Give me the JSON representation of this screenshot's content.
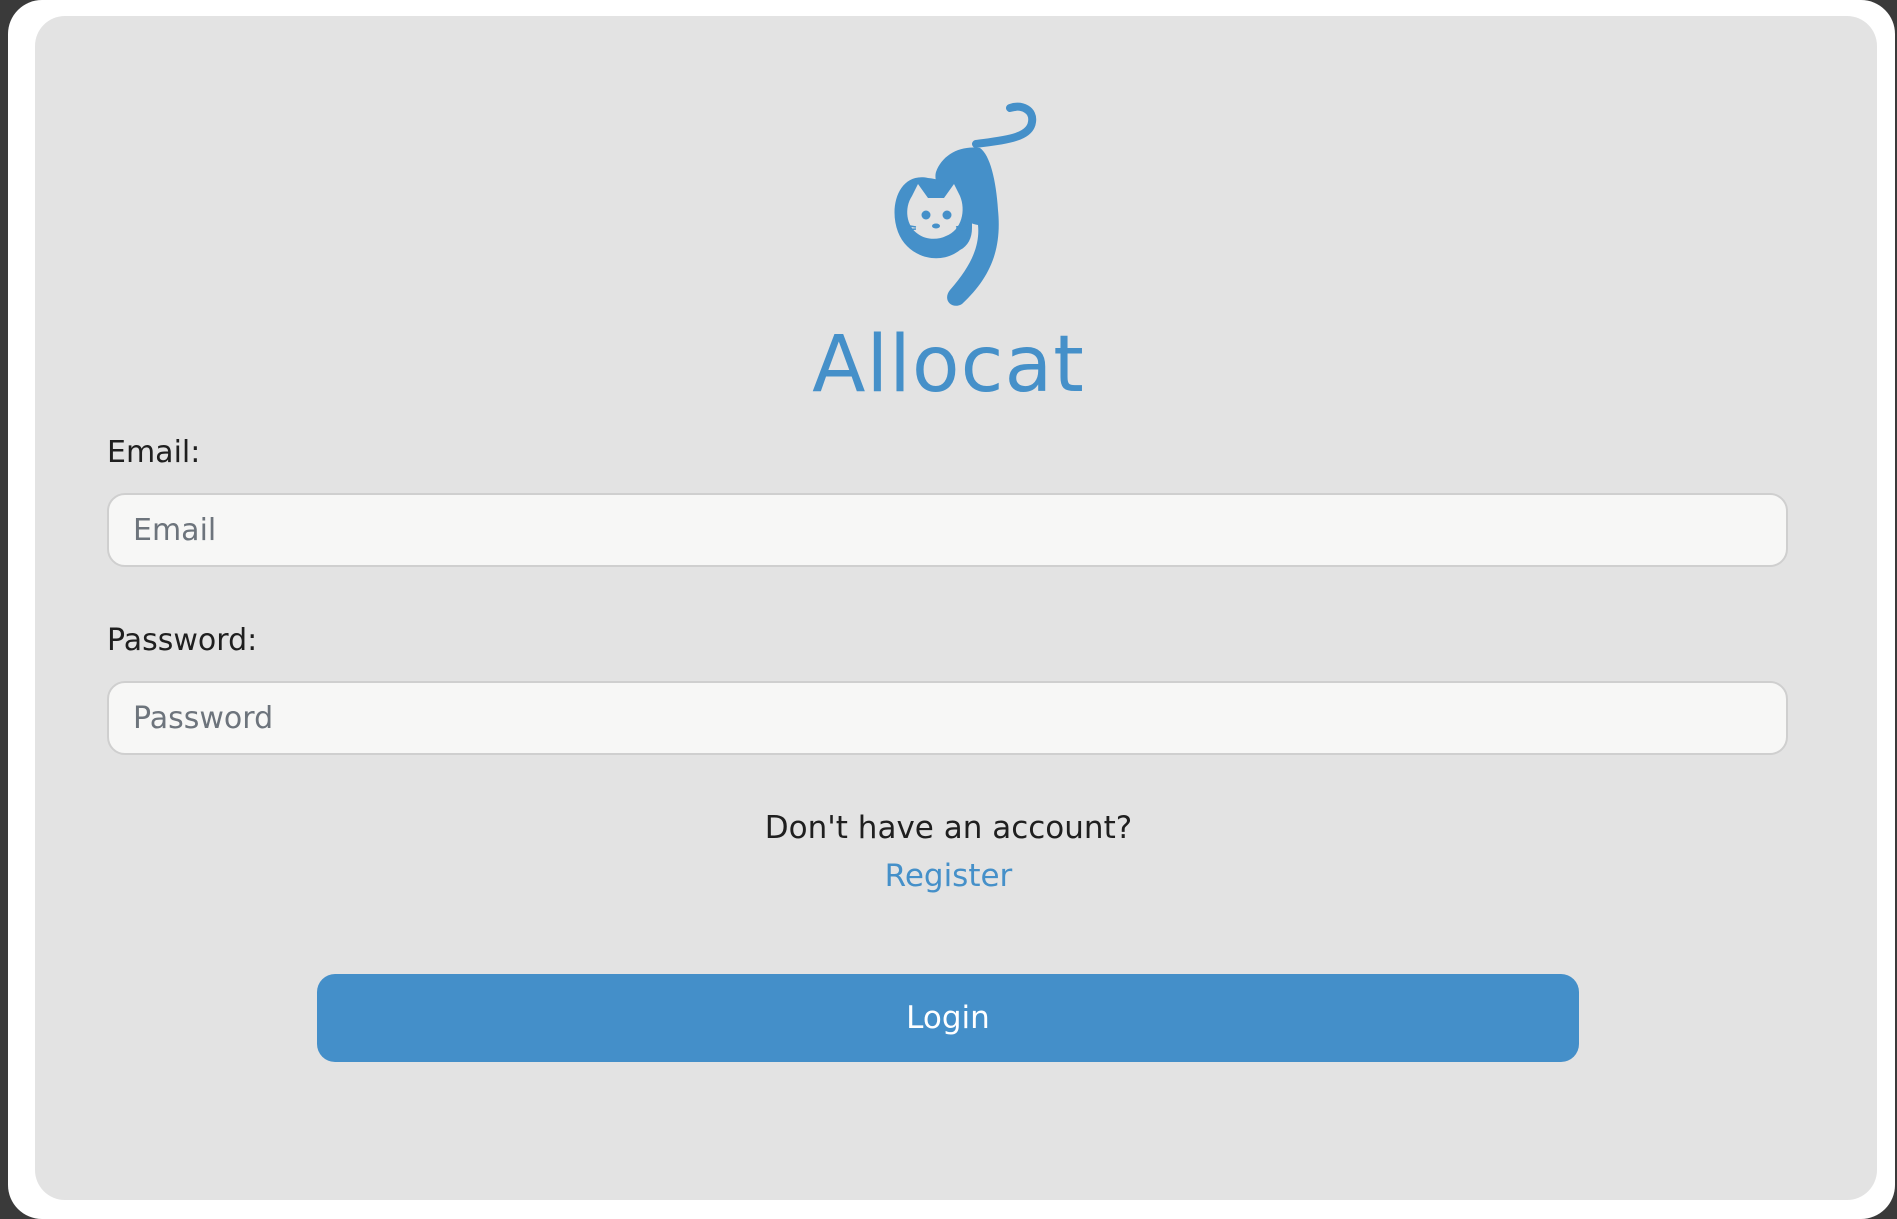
{
  "brand": {
    "name": "Allocat",
    "logo_icon": "cat-logo-icon",
    "color": "#4590c9"
  },
  "form": {
    "email": {
      "label": "Email:",
      "placeholder": "Email",
      "value": ""
    },
    "password": {
      "label": "Password:",
      "placeholder": "Password",
      "value": ""
    }
  },
  "register": {
    "prompt": "Don't have an account?",
    "link_label": "Register"
  },
  "login_button": {
    "label": "Login",
    "color": "#448fc9"
  },
  "colors": {
    "card_background": "#e3e3e3",
    "input_background": "#f7f7f6",
    "text": "#1f1f1f"
  }
}
